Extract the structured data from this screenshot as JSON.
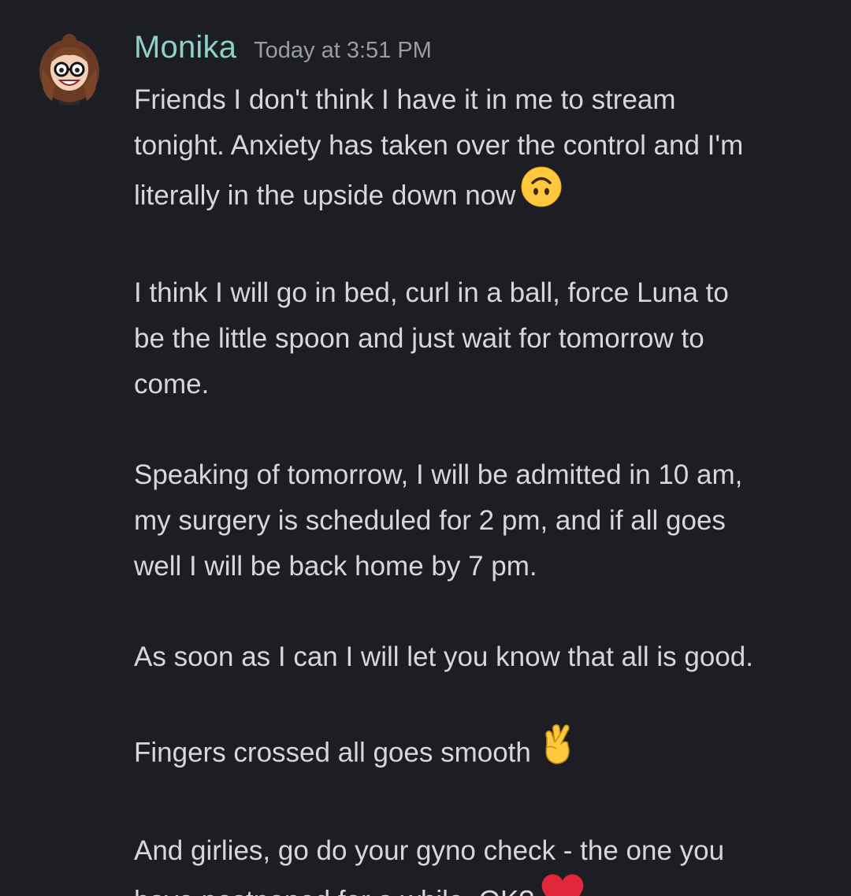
{
  "message": {
    "username": "Monika",
    "timestamp": "Today at 3:51 PM",
    "username_color": "#8fd0c7",
    "avatar_icon": "cartoon-woman-with-glasses-avatar",
    "paragraphs": {
      "p1": {
        "line1": "Friends I don't think I have it in me to stream",
        "line2": "tonight. Anxiety has taken over the control and I'm",
        "line3": "literally in the upside down now",
        "emoji": "upside-down-face-emoji"
      },
      "p2": {
        "line1": "I think I will go in bed, curl in a ball, force Luna to",
        "line2": "be the little spoon and just wait for tomorrow to",
        "line3": "come."
      },
      "p3": {
        "line1": "Speaking of tomorrow, I will be admitted in 10 am,",
        "line2": "my surgery is scheduled for 2 pm, and if all goes",
        "line3": "well I will be back home by 7 pm."
      },
      "p4": {
        "line1": "As soon as I can I will let you know that all is good."
      },
      "p5": {
        "line1": "Fingers crossed all goes smooth",
        "emoji": "crossed-fingers-emoji"
      },
      "p6": {
        "line1": "And girlies, go do your gyno check - the one you",
        "line2": "have postponed for a while. OK?",
        "emoji": "red-heart-emoji"
      }
    }
  }
}
